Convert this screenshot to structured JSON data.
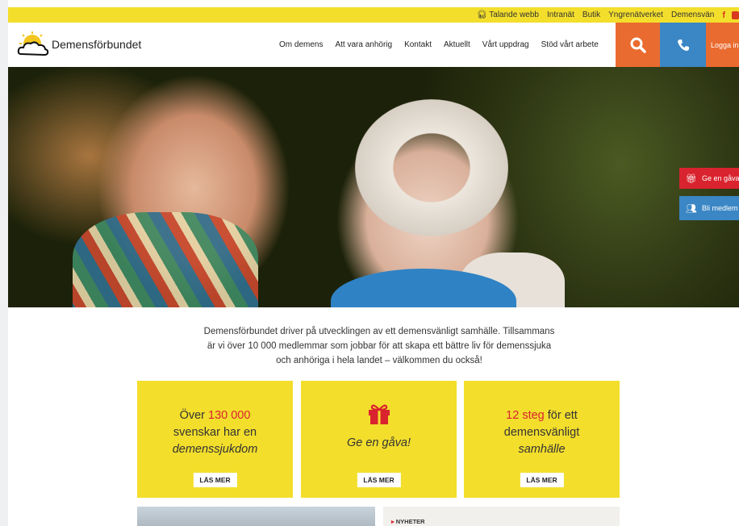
{
  "topbar": {
    "links": [
      "Talande webb",
      "Intranät",
      "Butik",
      "Yngrenätverket",
      "Demensvän"
    ],
    "headphone_icon": "headphones-icon",
    "facebook_icon": "f",
    "youtube_icon": "youtube-icon"
  },
  "header": {
    "logo_name": "Demensförbundet",
    "nav": [
      "Om demens",
      "Att vara anhörig",
      "Kontakt",
      "Aktuellt",
      "Vårt uppdrag",
      "Stöd vårt arbete"
    ],
    "login_label": "Logga in"
  },
  "side_buttons": {
    "gift_label": "Ge en gåva",
    "member_label": "Bli medlem"
  },
  "intro": {
    "line1": "Demensförbundet driver på utvecklingen av ett demensvänligt samhälle. Tillsammans",
    "line2": "är vi över 10 000 medlemmar som jobbar för att skapa ett bättre liv för demenssjuka",
    "line3": "och anhöriga i hela landet – välkommen du också!"
  },
  "cards": [
    {
      "pre": "Över ",
      "highlight": "130 000",
      "line2": "svenskar har en",
      "line3": "demenssjukdom",
      "button": "LÄS MER"
    },
    {
      "title": "Ge en gåva!",
      "button": "LÄS MER"
    },
    {
      "highlight": "12 steg",
      "post": " för ett",
      "line2": "demensvänligt",
      "line3": "samhälle",
      "button": "LÄS MER"
    }
  ],
  "news": {
    "label": "NYHETER"
  },
  "colors": {
    "yellow": "#f3de2c",
    "orange": "#ea6b2f",
    "blue": "#3b86c4",
    "red": "#d9232e"
  }
}
